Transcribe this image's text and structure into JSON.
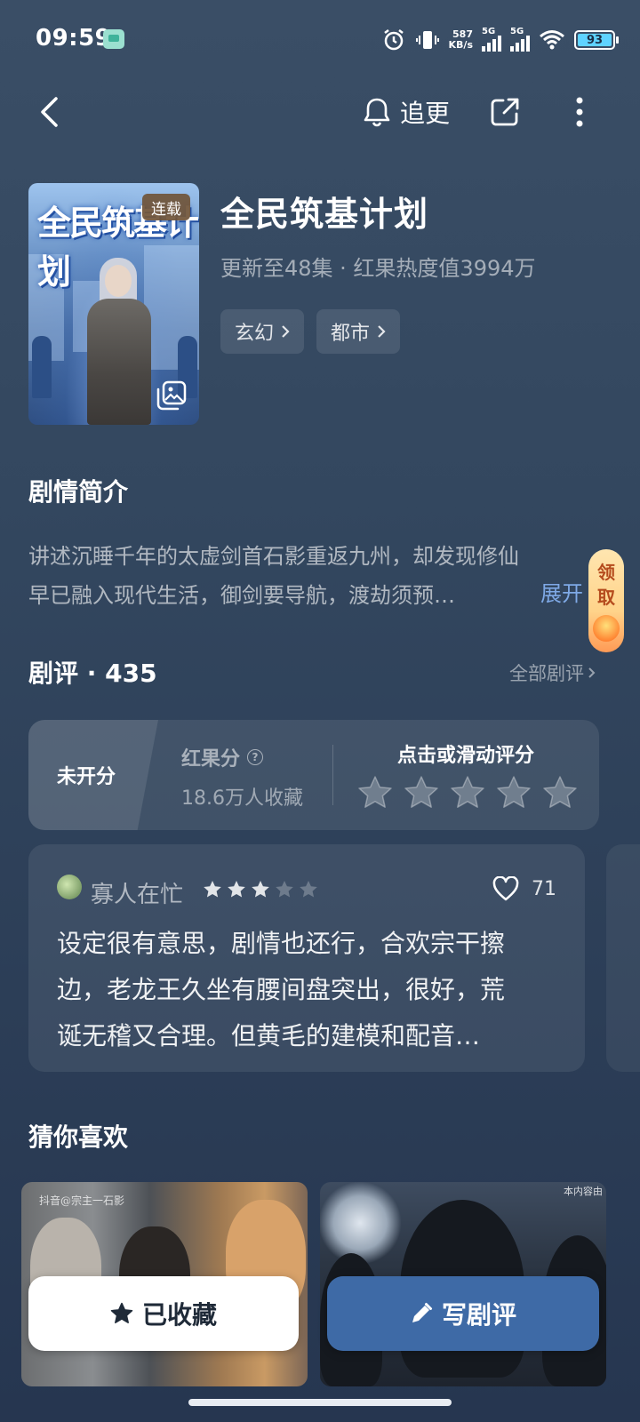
{
  "status_bar": {
    "time": "09:59",
    "net_speed_value": "587",
    "net_speed_unit": "KB/s",
    "sim1": "5G",
    "sim2": "5G",
    "battery": "93"
  },
  "nav": {
    "follow_label": "追更"
  },
  "drama": {
    "poster_title": "全民筑基计划",
    "badge": "连载",
    "title": "全民筑基计划",
    "meta": "更新至48集 · 红果热度值3994万",
    "tags": [
      {
        "label": "玄幻"
      },
      {
        "label": "都市"
      }
    ]
  },
  "synopsis": {
    "heading": "剧情简介",
    "line1": "讲述沉睡千年的太虚剑首石影重返九州，却发现修仙",
    "line2": "早已融入现代生活，御剑要导航，渡劫须预…",
    "expand_label": "展开"
  },
  "reward_float": {
    "char1": "领",
    "char2": "取"
  },
  "reviews": {
    "heading": "剧评 · 435",
    "all_label": "全部剧评"
  },
  "rating": {
    "score_status": "未开分",
    "score_label": "红果分",
    "help_glyph": "?",
    "collect_count": "18.6万人收藏",
    "prompt": "点击或滑动评分",
    "stars_total": 5
  },
  "review": {
    "user_name": "寡人在忙",
    "stars": 3,
    "stars_total": 5,
    "likes": "71",
    "line1": "设定很有意思，剧情也还行，合欢宗干擦",
    "line2": "边，老龙王久坐有腰间盘突出，很好，荒",
    "line3": "诞无稽又合理。但黄毛的建模和配音…"
  },
  "recommend": {
    "heading": "猜你喜欢",
    "card1_watermark": "抖音@宗主一石影",
    "card2_watermark": "本内容由"
  },
  "actions": {
    "collected_label": "已收藏",
    "write_review_label": "写剧评"
  },
  "colors": {
    "accent_blue": "#3e6aa6",
    "expand_blue": "#7fa9e6",
    "badge_brown": "#705438",
    "reward_orange": "#ff9a55"
  },
  "icons": [
    "back-arrow-icon",
    "bell-icon",
    "share-icon",
    "more-vertical-icon",
    "gallery-icon",
    "chevron-right-icon",
    "help-circle-icon",
    "star-icon",
    "heart-icon",
    "pencil-icon",
    "alarm-icon",
    "vibrate-icon",
    "wifi-icon",
    "signal-icon"
  ]
}
